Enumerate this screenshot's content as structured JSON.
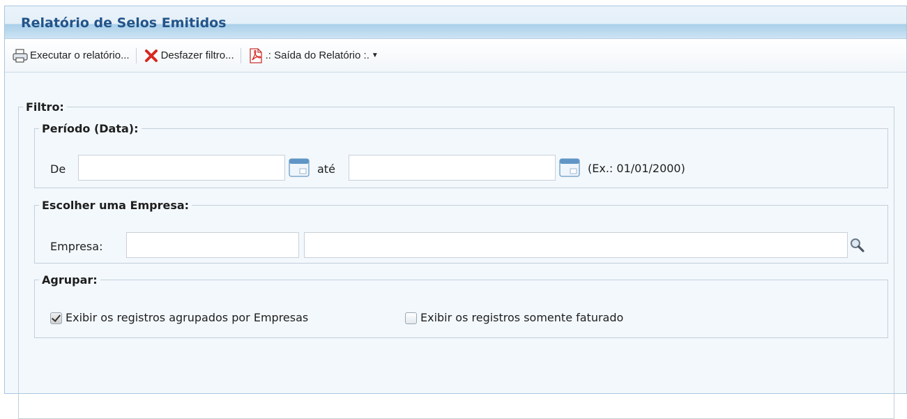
{
  "window": {
    "title": "Relatório de Selos Emitidos"
  },
  "toolbar": {
    "run_label": "Executar o relatório...",
    "undo_label": "Desfazer filtro...",
    "output_label": ".: Saída do Relatório :."
  },
  "filter": {
    "legend": "Filtro:",
    "period": {
      "legend": "Período (Data):",
      "from_label": "De",
      "from_value": "",
      "to_label": "até",
      "to_value": "",
      "example": "(Ex.: 01/01/2000)"
    },
    "company": {
      "legend": "Escolher uma Empresa:",
      "label": "Empresa:",
      "code_value": "",
      "name_value": ""
    },
    "group": {
      "legend": "Agrupar:",
      "option1_label": "Exibir os registros agrupados por Empresas",
      "option1_checked": true,
      "option2_label": "Exibir os registros somente faturado",
      "option2_checked": false
    }
  }
}
